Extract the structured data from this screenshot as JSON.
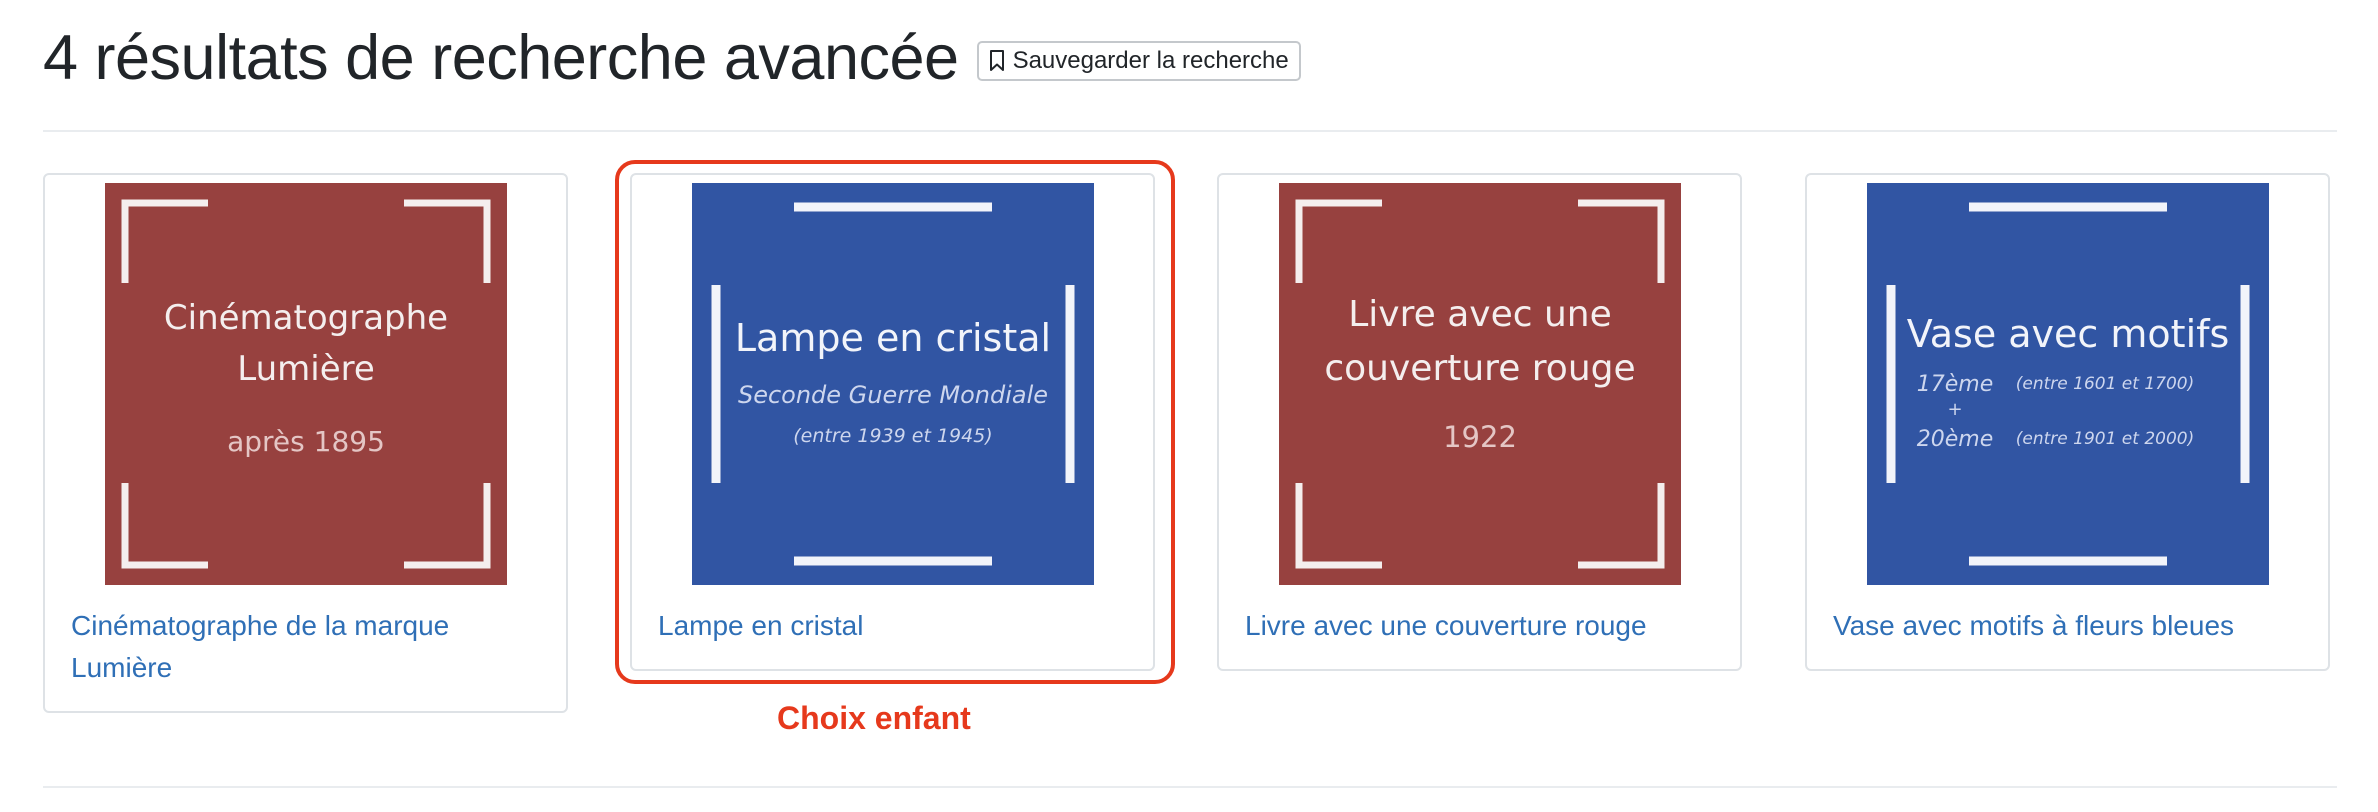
{
  "header": {
    "title": "4 résultats de recherche avancée",
    "save_button": "Sauvegarder la recherche"
  },
  "colors": {
    "red_tile": "#97413f",
    "blue_tile": "#3155a3",
    "link": "#2f6fb6",
    "highlight": "#e6391c"
  },
  "results": [
    {
      "title": "Cinématographe de la marque Lumière",
      "thumb": {
        "color": "red",
        "line1": "Cinématographe",
        "line2": "Lumière",
        "sub1": "après 1895"
      }
    },
    {
      "title": "Lampe en cristal",
      "thumb": {
        "color": "blue",
        "line1": "Lampe en cristal",
        "sub1": "Seconde Guerre Mondiale",
        "sub2": "(entre 1939 et 1945)"
      }
    },
    {
      "title": "Livre avec une couverture rouge",
      "thumb": {
        "color": "red",
        "line1": "Livre avec une",
        "line2": "couverture rouge",
        "sub1": "1922"
      }
    },
    {
      "title": "Vase avec motifs à fleurs bleues",
      "thumb": {
        "color": "blue",
        "line1": "Vase avec motifs",
        "period1": "17ème",
        "range1": "(entre 1601 et 1700)",
        "plus": "+",
        "period2": "20ème",
        "range2": "(entre 1901 et 2000)"
      }
    }
  ],
  "annotation": {
    "label": "Choix enfant"
  }
}
